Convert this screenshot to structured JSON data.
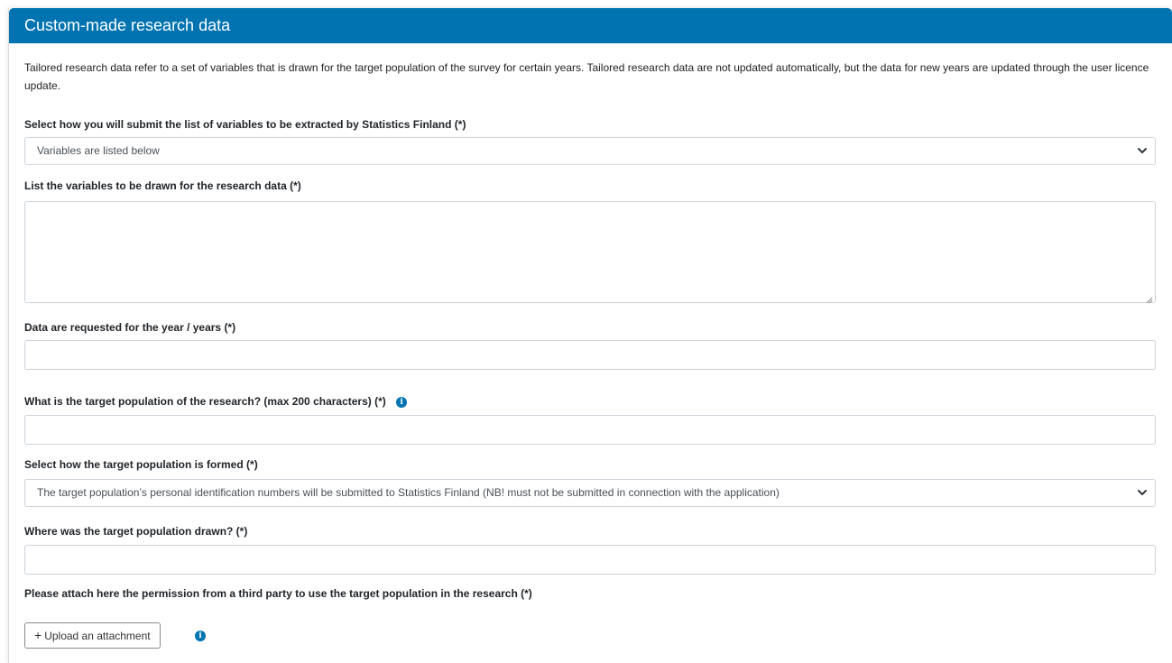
{
  "panel": {
    "title": "Custom-made research data",
    "intro": "Tailored research data refer to a set of variables that is drawn for the target population of the survey for certain years. Tailored research data are not updated automatically, but the data for new years are updated through the user licence update."
  },
  "fields": {
    "submit_method": {
      "label": "Select how you will submit the list of variables to be extracted by Statistics Finland (*)",
      "value": "Variables are listed below"
    },
    "variables_list": {
      "label": "List the variables to be drawn for the research data (*)",
      "value": ""
    },
    "years": {
      "label": "Data are requested for the year / years (*)",
      "value": ""
    },
    "target_population": {
      "label": "What is the target population of the research? (max 200 characters) (*)",
      "value": "",
      "info_icon": "info-icon"
    },
    "population_formed": {
      "label": "Select how the target population is formed (*)",
      "value": "The target population’s personal identification numbers will be submitted to Statistics Finland (NB! must not be submitted in connection with the application)"
    },
    "population_drawn": {
      "label": "Where was the target population drawn? (*)",
      "value": ""
    },
    "permission_attachment": {
      "label": "Please attach here the permission from a third party to use the target population in the research (*)",
      "button_label": "Upload an attachment",
      "info_icon": "info-icon"
    }
  },
  "colors": {
    "header_bg": "#0073b0",
    "info_icon": "#0073b0"
  }
}
